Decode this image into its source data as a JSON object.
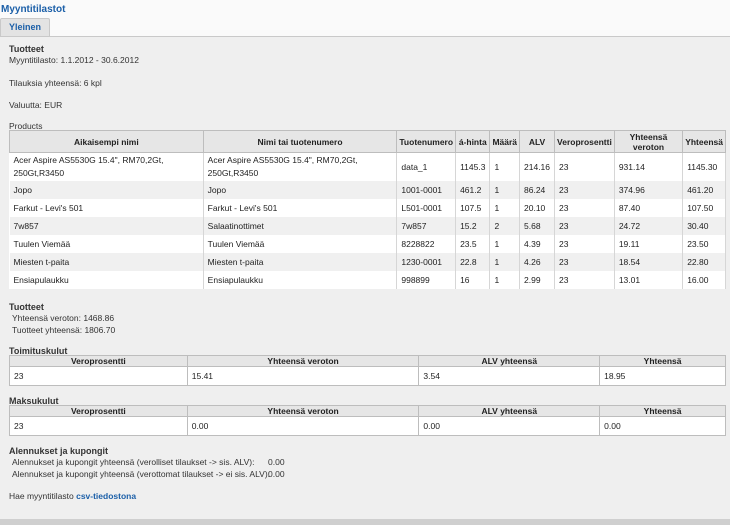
{
  "header": {
    "app_title": "Myyntitilastot",
    "tab_label": "Yleinen"
  },
  "summary": {
    "heading": "Tuotteet",
    "period": "Myyntitilasto: 1.1.2012 - 30.6.2012",
    "orders": "Tilauksia yhteensä: 6 kpl",
    "currency": "Valuutta: EUR",
    "products_label": "Products"
  },
  "products": {
    "columns": [
      "Aikaisempi nimi",
      "Nimi tai tuotenumero",
      "Tuotenumero",
      "á-hinta",
      "Määrä",
      "ALV",
      "Veroprosentti",
      "Yhteensä veroton",
      "Yhteensä"
    ],
    "rows": [
      [
        "Acer Aspire AS5530G 15.4\", RM70,2Gt, 250Gt,R3450",
        "Acer Aspire AS5530G 15.4\", RM70,2Gt, 250Gt,R3450",
        "data_1",
        "1145.3",
        "1",
        "214.16",
        "23",
        "931.14",
        "1145.30"
      ],
      [
        "Jopo",
        "Jopo",
        "1001-0001",
        "461.2",
        "1",
        "86.24",
        "23",
        "374.96",
        "461.20"
      ],
      [
        "Farkut - Levi's 501",
        "Farkut - Levi's 501",
        "L501-0001",
        "107.5",
        "1",
        "20.10",
        "23",
        "87.40",
        "107.50"
      ],
      [
        "7w857",
        "Salaatinottimet",
        "7w857",
        "15.2",
        "2",
        "5.68",
        "23",
        "24.72",
        "30.40"
      ],
      [
        "Tuulen Viemää",
        "Tuulen Viemää",
        "8228822",
        "23.5",
        "1",
        "4.39",
        "23",
        "19.11",
        "23.50"
      ],
      [
        "Miesten t-paita",
        "Miesten t-paita",
        "1230-0001",
        "22.8",
        "1",
        "4.26",
        "23",
        "18.54",
        "22.80"
      ],
      [
        "Ensiapulaukku",
        "Ensiapulaukku",
        "998899",
        "16",
        "1",
        "2.99",
        "23",
        "13.01",
        "16.00"
      ]
    ]
  },
  "totals": {
    "heading": "Tuotteet",
    "net": "Yhteensä veroton:  1468.86",
    "gross": "Tuotteet yhteensä: 1806.70"
  },
  "shipping": {
    "heading": "Toimituskulut",
    "columns": [
      "Veroprosentti",
      "Yhteensä veroton",
      "ALV yhteensä",
      "Yhteensä"
    ],
    "row": [
      "23",
      "15.41",
      "3.54",
      "18.95"
    ]
  },
  "payment": {
    "heading": "Maksukulut",
    "columns": [
      "Veroprosentti",
      "Yhteensä veroton",
      "ALV yhteensä",
      "Yhteensä"
    ],
    "row": [
      "23",
      "0.00",
      "0.00",
      "0.00"
    ]
  },
  "discounts": {
    "heading": "Alennukset ja kupongit",
    "line1_label": "Alennukset ja kupongit yhteensä (verolliset tilaukset -> sis. ALV):",
    "line1_value": "0.00",
    "line2_label": "Alennukset ja kupongit yhteensä (verottomat tilaukset -> ei sis. ALV):",
    "line2_value": "0.00"
  },
  "csv": {
    "prefix": "Hae myyntitilasto ",
    "link": "csv-tiedostona"
  }
}
